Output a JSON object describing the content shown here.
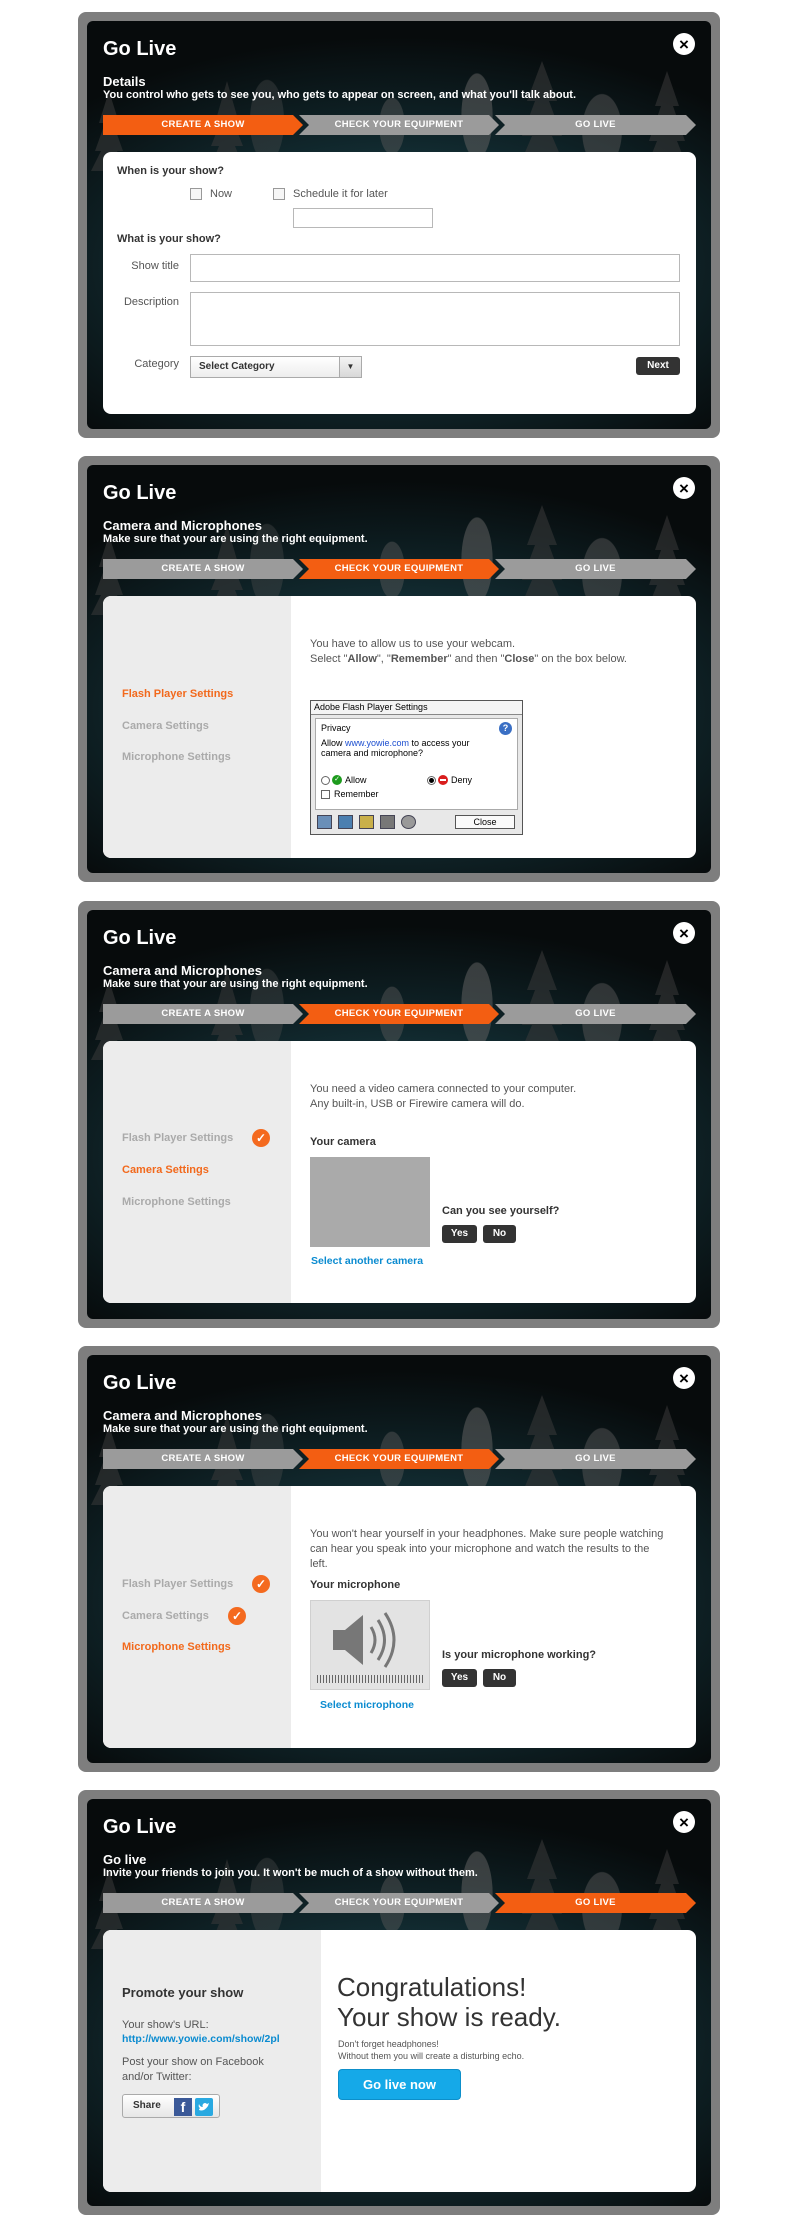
{
  "window_title": "Go Live",
  "close_glyph": "×",
  "steps": [
    "Create a show",
    "Check your equipment",
    "Go live"
  ],
  "step_colors": {
    "active": "#f35e12",
    "inactive": "#9b9b9b"
  },
  "panel1": {
    "heading": "Details",
    "subheading": "You control who gets to see you, who gets to appear on screen, and what you'll talk about.",
    "when_label": "When is your show?",
    "option_now": "Now",
    "option_later": "Schedule it for later",
    "what_label": "What is your show?",
    "show_title_label": "Show title",
    "description_label": "Description",
    "category_label": "Category",
    "category_value": "Select Category",
    "next_button": "Next"
  },
  "equipment_heading": "Camera and Microphones",
  "equipment_subheading": "Make sure that your are using the right equipment.",
  "sidebar": [
    "Flash Player Settings",
    "Camera Settings",
    "Microphone Settings"
  ],
  "panel2": {
    "instruction_line1": "You have to allow us to use your webcam.",
    "instruction_line2_pre": "Select \"",
    "allow_word": "Allow",
    "sep1": "\", \"",
    "remember_word": "Remember",
    "sep2": "\" and then \"",
    "close_word": "Close",
    "instruction_line2_post": "\" on the box below.",
    "flash_dialog": {
      "title": "Adobe Flash Player Settings",
      "tab": "Privacy",
      "help": "?",
      "text_pre": "Allow ",
      "url": "www.yowie.com",
      "text_post": " to access your camera and microphone?",
      "allow": "Allow",
      "deny": "Deny",
      "remember": "Remember",
      "close": "Close"
    }
  },
  "panel3": {
    "instruction_line1": "You need a video camera connected to your computer.",
    "instruction_line2": "Any built-in, USB or Firewire camera will do.",
    "your_camera": "Your camera",
    "question": "Can you see yourself?",
    "yes": "Yes",
    "no": "No",
    "select_link": "Select another camera"
  },
  "panel4": {
    "instruction": "You won't hear yourself in your headphones. Make sure people watching can hear you speak into your microphone and watch the results to the left.",
    "your_microphone": "Your microphone",
    "question": "Is your microphone working?",
    "yes": "Yes",
    "no": "No",
    "select_link": "Select microphone"
  },
  "panel5": {
    "heading": "Go live",
    "subheading": "Invite your friends to join you. It won't be much of a show without them.",
    "promote_title": "Promote your show",
    "url_label": "Your show's URL:",
    "url_value": "http://www.yowie.com/show/2pl",
    "post_text": "Post your show on Facebook and/or Twitter:",
    "share_label": "Share",
    "facebook_glyph": "f",
    "congrats_line1": "Congratulations!",
    "congrats_line2": "Your show is ready.",
    "note_line1": "Don't forget headphones!",
    "note_line2": "Without them you will create a disturbing echo.",
    "go_live_button": "Go live now"
  }
}
